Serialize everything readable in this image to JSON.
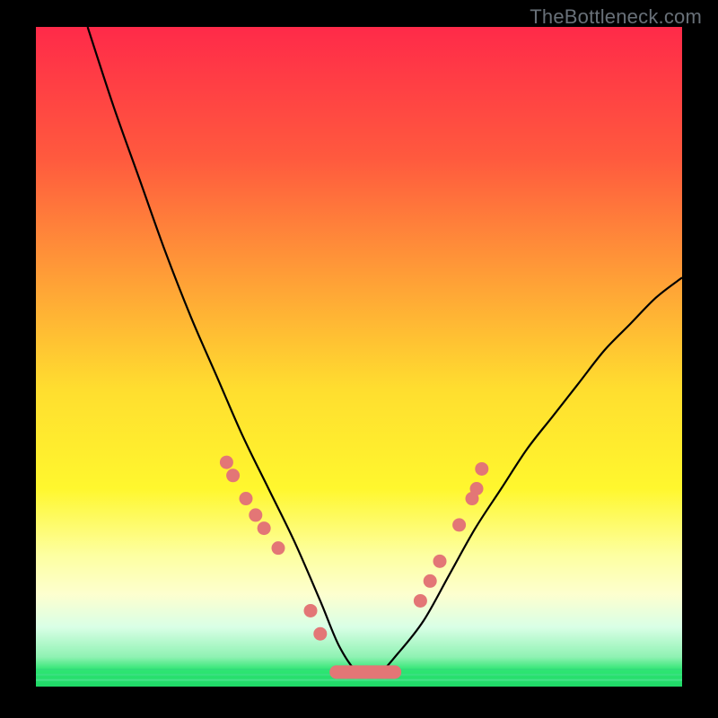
{
  "watermark_text": "TheBottleneck.com",
  "chart_data": {
    "type": "line",
    "title": "",
    "xlabel": "",
    "ylabel": "",
    "xlim": [
      0,
      100
    ],
    "ylim": [
      0,
      100
    ],
    "grid": false,
    "legend": false,
    "series": [
      {
        "name": "curve",
        "type": "line",
        "color": "#000000",
        "x": [
          8,
          12,
          16,
          20,
          24,
          28,
          32,
          36,
          40,
          44,
          47,
          50,
          53,
          56,
          60,
          64,
          68,
          72,
          76,
          80,
          84,
          88,
          92,
          96,
          100
        ],
        "y": [
          100,
          88,
          77,
          66,
          56,
          47,
          38,
          30,
          22,
          13,
          6,
          2,
          2,
          5,
          10,
          17,
          24,
          30,
          36,
          41,
          46,
          51,
          55,
          59,
          62
        ]
      },
      {
        "name": "bottom-band",
        "type": "area",
        "color": "#2ee672",
        "x": [
          0,
          100
        ],
        "y": [
          2.5,
          2.5
        ]
      },
      {
        "name": "markers-left",
        "type": "scatter",
        "color": "#e37676",
        "x": [
          29.5,
          30.5,
          32.5,
          34.0,
          35.3,
          37.5,
          42.5,
          44.0
        ],
        "y": [
          34.0,
          32.0,
          28.5,
          26.0,
          24.0,
          21.0,
          11.5,
          8.0
        ]
      },
      {
        "name": "markers-right",
        "type": "scatter",
        "color": "#e37676",
        "x": [
          59.5,
          61.0,
          62.5,
          65.5,
          67.5,
          68.2,
          69.0
        ],
        "y": [
          13.0,
          16.0,
          19.0,
          24.5,
          28.5,
          30.0,
          33.0
        ]
      },
      {
        "name": "markers-bottom",
        "type": "scatter",
        "color": "#e37676",
        "x": [
          46.5,
          48.0,
          49.5,
          51.0,
          52.5,
          54.0,
          55.5
        ],
        "y": [
          2.2,
          2.2,
          2.2,
          2.2,
          2.2,
          2.2,
          2.2
        ]
      }
    ],
    "gradient_stops": [
      {
        "offset": 0.0,
        "color": "#ff2a49"
      },
      {
        "offset": 0.2,
        "color": "#ff5a3e"
      },
      {
        "offset": 0.4,
        "color": "#ffa636"
      },
      {
        "offset": 0.55,
        "color": "#ffde2f"
      },
      {
        "offset": 0.7,
        "color": "#fff72e"
      },
      {
        "offset": 0.8,
        "color": "#fdffa0"
      },
      {
        "offset": 0.86,
        "color": "#fdffcf"
      },
      {
        "offset": 0.91,
        "color": "#d9ffe6"
      },
      {
        "offset": 0.955,
        "color": "#8ff2b3"
      },
      {
        "offset": 0.975,
        "color": "#2ee672"
      },
      {
        "offset": 1.0,
        "color": "#1fd867"
      }
    ]
  }
}
